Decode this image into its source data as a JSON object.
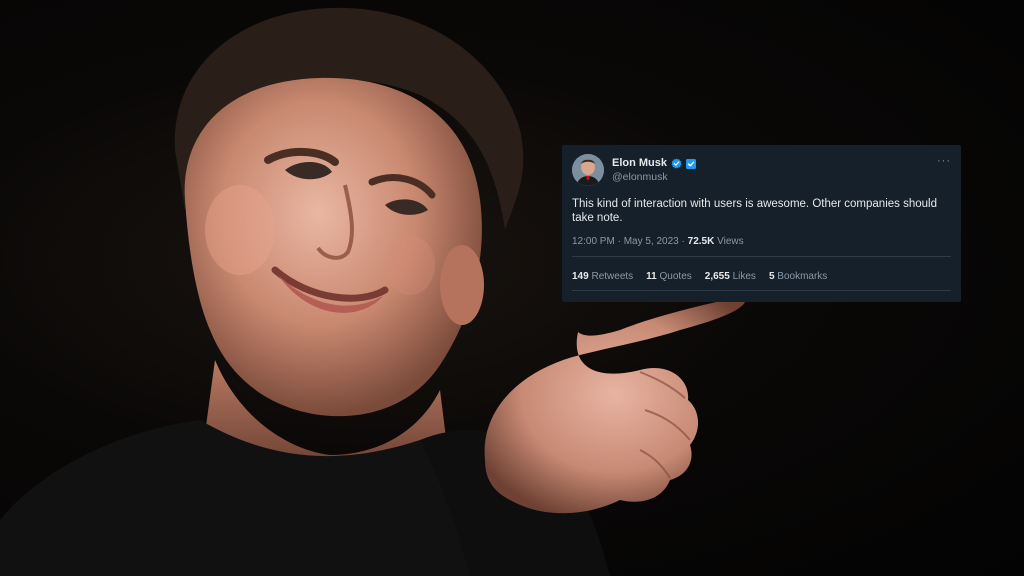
{
  "tweet": {
    "display_name": "Elon Musk",
    "handle": "@elonmusk",
    "text": "This kind of interaction with users is awesome. Other companies should take note.",
    "time": "12:00 PM",
    "separator": " · ",
    "date": "May 5, 2023",
    "views_count": "72.5K",
    "views_label": "Views",
    "more_glyph": "···",
    "stats": [
      {
        "count": "149",
        "label": "Retweets"
      },
      {
        "count": "11",
        "label": "Quotes"
      },
      {
        "count": "2,655",
        "label": "Likes"
      },
      {
        "count": "5",
        "label": "Bookmarks"
      }
    ],
    "badges": [
      "verified-badge-icon",
      "affiliate-square-badge-icon"
    ],
    "colors": {
      "card_bg": "#15202b",
      "text": "#e7e9ea",
      "muted": "#8b98a5",
      "verified": "#1d9bf0"
    }
  }
}
